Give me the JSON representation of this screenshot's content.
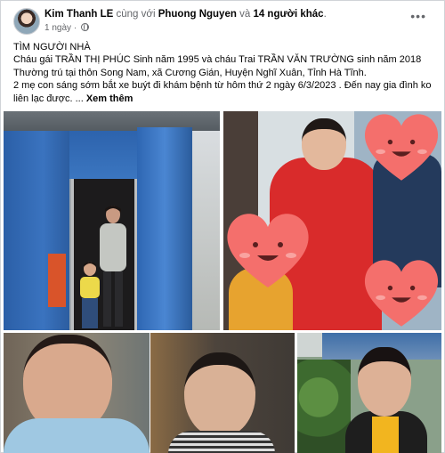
{
  "post": {
    "author": "Kim Thanh LE",
    "with_text": "cùng với",
    "tagged": "Phuong Nguyen",
    "and_text": "và",
    "others": "14 người khác",
    "time": "1 ngày",
    "privacy_icon": "globe-icon",
    "more_icon": "more-horizontal-icon",
    "lines": [
      "TÌM NGƯỜI NHÀ",
      "Cháu gái TRẦN THỊ PHÚC  Sinh năm 1995 và cháu Trai TRẦN VĂN TRƯỜNG sinh năm 2018",
      "Thường trú tại thôn Song Nam, xã Cương Gián, Huyện Nghĩ Xuân, Tỉnh Hà Tĩnh.",
      "2 mẹ con sáng sớm bắt xe buýt đi khám bệnh từ hôm thứ 2 ngày 6/3/2023 . Đến nay gia đình ko"
    ],
    "last_line": "liên lạc được. ...",
    "see_more": "Xem thêm"
  }
}
